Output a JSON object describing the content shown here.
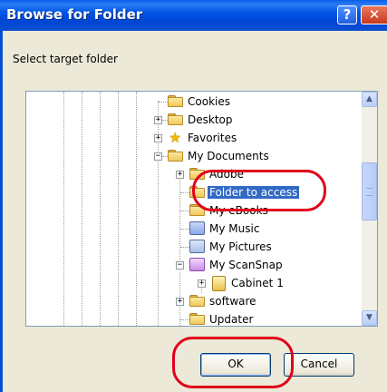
{
  "window": {
    "title": "Browse for Folder",
    "instruction": "Select target folder"
  },
  "titlebar_buttons": {
    "help_glyph": "?",
    "close_glyph": "✕"
  },
  "tree": {
    "items": [
      {
        "label": "Cookies",
        "icon": "folder-icon"
      },
      {
        "label": "Desktop",
        "icon": "folder-icon",
        "expander": "+"
      },
      {
        "label": "Favorites",
        "icon": "favorites-star-icon",
        "expander": "+"
      },
      {
        "label": "My Documents",
        "icon": "folder-icon",
        "expander": "−"
      },
      {
        "label": "Adobe",
        "icon": "folder-icon",
        "expander": "+"
      },
      {
        "label": "Folder to access",
        "icon": "folder-icon",
        "selected": true
      },
      {
        "label": "My eBooks",
        "icon": "folder-icon"
      },
      {
        "label": "My Music",
        "icon": "music-folder-icon"
      },
      {
        "label": "My Pictures",
        "icon": "pictures-folder-icon"
      },
      {
        "label": "My ScanSnap",
        "icon": "scansnap-folder-icon",
        "expander": "−"
      },
      {
        "label": "Cabinet 1",
        "icon": "cabinet-icon",
        "expander": "+"
      },
      {
        "label": "software",
        "icon": "folder-icon",
        "expander": "+"
      },
      {
        "label": "Updater",
        "icon": "folder-icon"
      }
    ]
  },
  "scrollbar": {
    "up_glyph": "▲",
    "down_glyph": "▼"
  },
  "buttons": {
    "ok": "OK",
    "cancel": "Cancel"
  },
  "colors": {
    "titlebar": "#0055e5",
    "selection": "#316ac5",
    "highlight_ring": "#e2001a"
  }
}
